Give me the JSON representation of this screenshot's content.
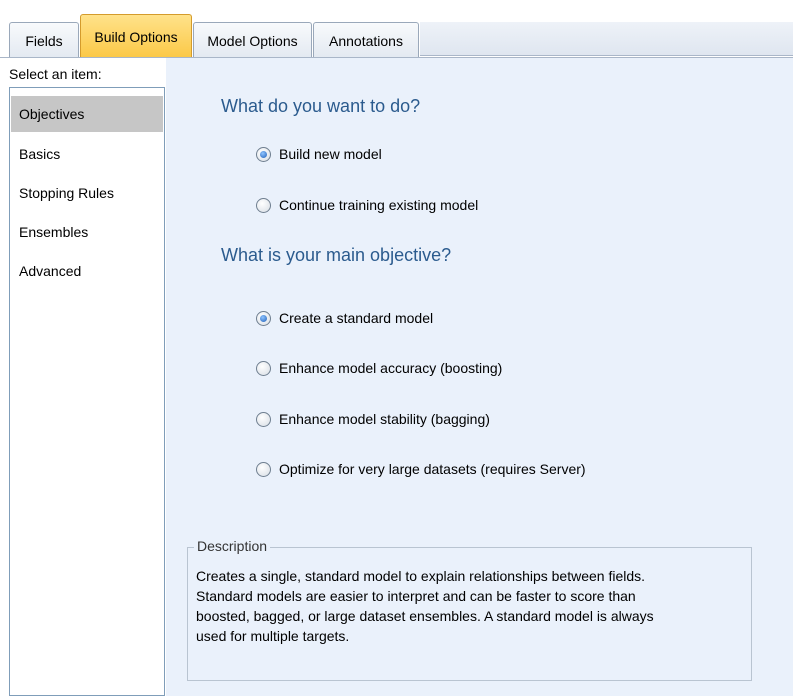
{
  "tabs": [
    {
      "label": "Fields",
      "active": false
    },
    {
      "label": "Build Options",
      "active": true
    },
    {
      "label": "Model Options",
      "active": false
    },
    {
      "label": "Annotations",
      "active": false
    }
  ],
  "sidebar": {
    "select_label": "Select an item:",
    "items": [
      {
        "label": "Objectives",
        "selected": true
      },
      {
        "label": "Basics",
        "selected": false
      },
      {
        "label": "Stopping Rules",
        "selected": false
      },
      {
        "label": "Ensembles",
        "selected": false
      },
      {
        "label": "Advanced",
        "selected": false
      }
    ]
  },
  "main": {
    "what_to_do": {
      "heading": "What do you want to do?",
      "options": [
        {
          "label": "Build new model",
          "checked": true
        },
        {
          "label": "Continue training existing model",
          "checked": false
        }
      ]
    },
    "objective": {
      "heading": "What is your main objective?",
      "options": [
        {
          "label": "Create a standard model",
          "checked": true
        },
        {
          "label": "Enhance model accuracy (boosting)",
          "checked": false
        },
        {
          "label": "Enhance model stability (bagging)",
          "checked": false
        },
        {
          "label": "Optimize for very large datasets (requires Server)",
          "checked": false
        }
      ]
    },
    "description": {
      "legend": "Description",
      "lines": [
        "Creates a single, standard model to explain relationships between fields.",
        "Standard models are easier to interpret and can be faster to score than",
        "boosted, bagged, or large dataset ensembles. A standard model is always",
        "used for multiple targets."
      ]
    }
  },
  "colors": {
    "active_tab": "#fbc846",
    "panel_background": "#eaf1fb",
    "heading": "#2b5b8e",
    "selected_item": "#c6c6c6"
  }
}
